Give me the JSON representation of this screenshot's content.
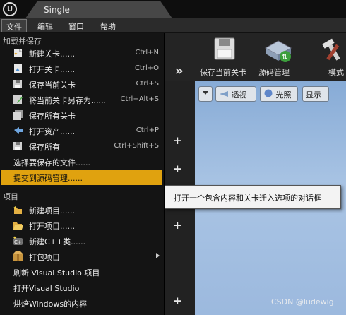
{
  "window": {
    "app_logo": "U",
    "tab_title": "Single"
  },
  "menubar": {
    "items": [
      "文件",
      "编辑",
      "窗口",
      "帮助"
    ]
  },
  "file_menu": {
    "section_load_save": "加载并保存",
    "items": [
      {
        "label": "新建关卡......",
        "shortcut": "Ctrl+N",
        "icon": "new-level-icon"
      },
      {
        "label": "打开关卡......",
        "shortcut": "Ctrl+O",
        "icon": "open-level-icon"
      },
      {
        "label": "保存当前关卡",
        "shortcut": "Ctrl+S",
        "icon": "save-icon"
      },
      {
        "label": "将当前关卡另存为......",
        "shortcut": "Ctrl+Alt+S",
        "icon": "save-as-icon"
      },
      {
        "label": "保存所有关卡",
        "shortcut": "",
        "icon": "save-all-levels-icon"
      },
      {
        "label": "打开资产......",
        "shortcut": "Ctrl+P",
        "icon": "open-asset-icon"
      },
      {
        "label": "保存所有",
        "shortcut": "Ctrl+Shift+S",
        "icon": "save-all-icon"
      },
      {
        "label": "选择要保存的文件......",
        "shortcut": ""
      },
      {
        "label": "提交到源码管理......",
        "shortcut": ""
      }
    ],
    "section_project": "项目",
    "project_items": [
      {
        "label": "新建项目......",
        "icon": "new-project-icon"
      },
      {
        "label": "打开项目......",
        "icon": "open-project-icon"
      },
      {
        "label": "新建C++类......",
        "icon": "new-cpp-class-icon"
      },
      {
        "label": "打包项目",
        "icon": "package-project-icon"
      },
      {
        "label": "刷新 Visual Studio 项目"
      },
      {
        "label": "打开Visual Studio"
      },
      {
        "label": "烘焙Windows的内容"
      }
    ]
  },
  "toolbar": {
    "save_label": "保存当前关卡",
    "source_control_label": "源码管理",
    "modes_label": "模式"
  },
  "viewport": {
    "perspective": "透视",
    "lit": "光照",
    "show": "显示"
  },
  "tooltip": "打开一个包含内容和关卡迁入选项的对话框",
  "watermark": "CSDN @ludewig"
}
